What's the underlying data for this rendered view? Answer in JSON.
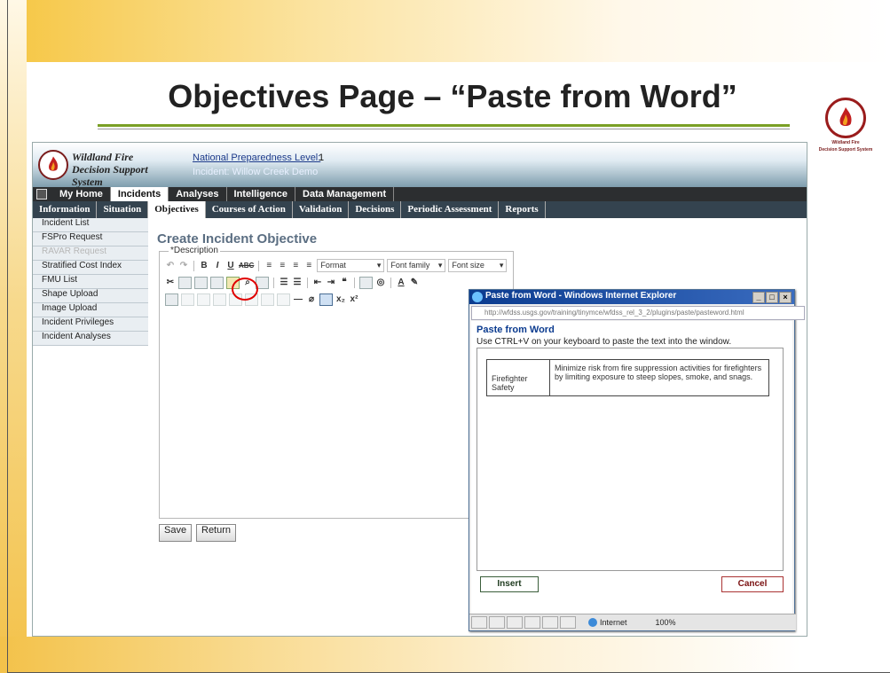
{
  "slide": {
    "title": "Objectives Page – “Paste from Word”",
    "corner_logo_text": [
      "Wildland Fire",
      "Decision Support System"
    ]
  },
  "app": {
    "name_line1": "Wildland Fire",
    "name_line2": "Decision Support System",
    "npl_label": "National Preparedness Level:",
    "npl_value": "1",
    "incident_line": "Incident: Willow Creek Demo",
    "main_nav": [
      "My Home",
      "Incidents",
      "Analyses",
      "Intelligence",
      "Data Management"
    ],
    "main_nav_active": "Incidents",
    "sub_nav": [
      "Information",
      "Situation",
      "Objectives",
      "Courses of Action",
      "Validation",
      "Decisions",
      "Periodic Assessment",
      "Reports"
    ],
    "sub_nav_active": "Objectives",
    "sidebar": [
      {
        "label": "Incident List",
        "disabled": false
      },
      {
        "label": "FSPro Request",
        "disabled": false
      },
      {
        "label": "RAVAR Request",
        "disabled": true
      },
      {
        "label": "Stratified Cost Index",
        "disabled": false
      },
      {
        "label": "FMU List",
        "disabled": false
      },
      {
        "label": "Shape Upload",
        "disabled": false
      },
      {
        "label": "Image Upload",
        "disabled": false
      },
      {
        "label": "Incident Privileges",
        "disabled": false
      },
      {
        "label": "Incident Analyses",
        "disabled": false
      }
    ],
    "heading": "Create Incident Objective",
    "description_label": "*Description",
    "toolbar": {
      "format": "Format",
      "font_family": "Font family",
      "font_size": "Font size"
    },
    "save": "Save",
    "return": "Return"
  },
  "popup": {
    "title": "Paste from Word - Windows Internet Explorer",
    "url": "http://wfdss.usgs.gov/training/tinymce/wfdss_rel_3_2/plugins/paste/pasteword.html",
    "heading": "Paste from Word",
    "instructions": "Use CTRL+V on your keyboard to paste the text into the window.",
    "table": {
      "col1": "Firefighter Safety",
      "col2": "Minimize risk from fire suppression activities for firefighters by limiting exposure to steep slopes, smoke, and snags."
    },
    "insert": "Insert",
    "cancel": "Cancel",
    "status_zone": "Internet",
    "zoom": "100%"
  },
  "colors": {
    "accent_green": "#7a9f25",
    "header_blue": "#7e9dad",
    "highlight_red": "#e00000",
    "popup_titlebar": "#0b3b8f"
  }
}
